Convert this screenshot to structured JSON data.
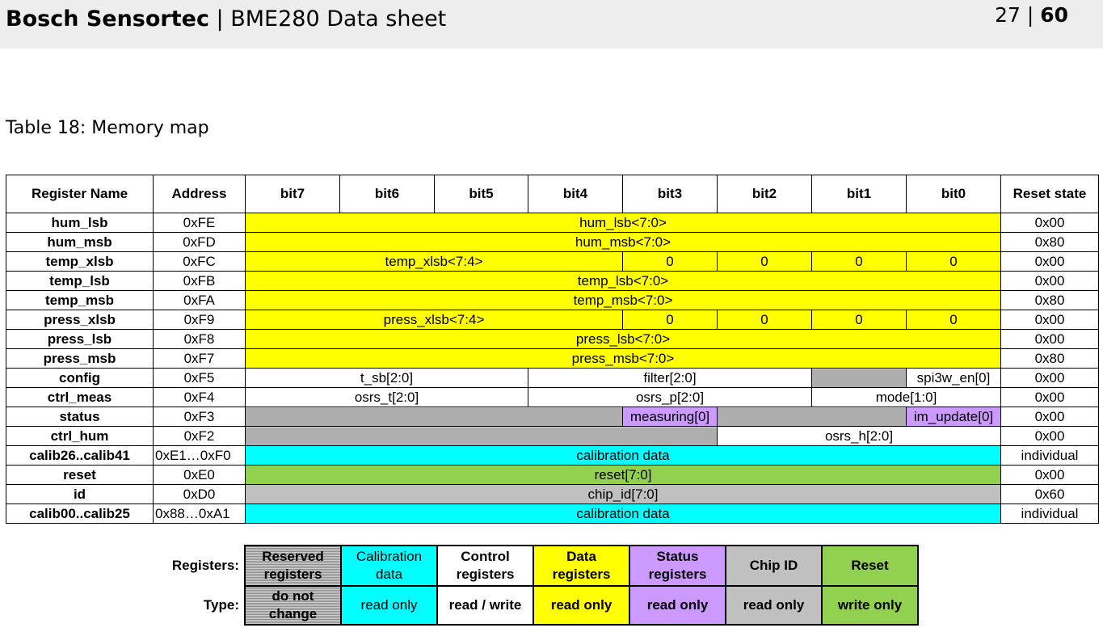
{
  "header": {
    "brand": "Bosch Sensortec",
    "separator": " | ",
    "doc_title": "BME280 Data sheet",
    "page_current": "27",
    "page_sep": " | ",
    "page_total": "60"
  },
  "caption": "Table 18: Memory map",
  "columns": {
    "register_name": "Register Name",
    "address": "Address",
    "bit7": "bit7",
    "bit6": "bit6",
    "bit5": "bit5",
    "bit4": "bit4",
    "bit3": "bit3",
    "bit2": "bit2",
    "bit1": "bit1",
    "bit0": "bit0",
    "reset_state": "Reset state"
  },
  "rows": {
    "hum_lsb": {
      "name": "hum_lsb",
      "address": "0xFE",
      "field": "hum_lsb<7:0>",
      "reset": "0x00"
    },
    "hum_msb": {
      "name": "hum_msb",
      "address": "0xFD",
      "field": "hum_msb<7:0>",
      "reset": "0x80"
    },
    "temp_xlsb": {
      "name": "temp_xlsb",
      "address": "0xFC",
      "field": "temp_xlsb<7:4>",
      "b3": "0",
      "b2": "0",
      "b1": "0",
      "b0": "0",
      "reset": "0x00"
    },
    "temp_lsb": {
      "name": "temp_lsb",
      "address": "0xFB",
      "field": "temp_lsb<7:0>",
      "reset": "0x00"
    },
    "temp_msb": {
      "name": "temp_msb",
      "address": "0xFA",
      "field": "temp_msb<7:0>",
      "reset": "0x80"
    },
    "press_xlsb": {
      "name": "press_xlsb",
      "address": "0xF9",
      "field": "press_xlsb<7:4>",
      "b3": "0",
      "b2": "0",
      "b1": "0",
      "b0": "0",
      "reset": "0x00"
    },
    "press_lsb": {
      "name": "press_lsb",
      "address": "0xF8",
      "field": "press_lsb<7:0>",
      "reset": "0x00"
    },
    "press_msb": {
      "name": "press_msb",
      "address": "0xF7",
      "field": "press_msb<7:0>",
      "reset": "0x80"
    },
    "config": {
      "name": "config",
      "address": "0xF5",
      "t_sb": "t_sb[2:0]",
      "filter": "filter[2:0]",
      "spi3w": "spi3w_en[0]",
      "reset": "0x00"
    },
    "ctrl_meas": {
      "name": "ctrl_meas",
      "address": "0xF4",
      "osrs_t": "osrs_t[2:0]",
      "osrs_p": "osrs_p[2:0]",
      "mode": "mode[1:0]",
      "reset": "0x00"
    },
    "status": {
      "name": "status",
      "address": "0xF3",
      "measuring": "measuring[0]",
      "im_update": "im_update[0]",
      "reset": "0x00"
    },
    "ctrl_hum": {
      "name": "ctrl_hum",
      "address": "0xF2",
      "osrs_h": "osrs_h[2:0]",
      "reset": "0x00"
    },
    "calib26": {
      "name": "calib26..calib41",
      "address": "0xE1…0xF0",
      "field": "calibration data",
      "reset": "individual"
    },
    "reset": {
      "name": "reset",
      "address": "0xE0",
      "field": "reset[7:0]",
      "reset": "0x00"
    },
    "id": {
      "name": "id",
      "address": "0xD0",
      "field": "chip_id[7:0]",
      "reset": "0x60"
    },
    "calib00": {
      "name": "calib00..calib25",
      "address": "0x88…0xA1",
      "field": "calibration data",
      "reset": "individual"
    }
  },
  "legend": {
    "registers_label": "Registers:",
    "type_label": "Type:",
    "items": [
      {
        "register": "Reserved registers",
        "type": "do not change"
      },
      {
        "register": "Calibration data",
        "type": "read only"
      },
      {
        "register": "Control registers",
        "type": "read / write"
      },
      {
        "register": "Data registers",
        "type": "read only"
      },
      {
        "register": "Status registers",
        "type": "read only"
      },
      {
        "register": "Chip ID",
        "type": "read only"
      },
      {
        "register": "Reset",
        "type": "write only"
      }
    ]
  },
  "colors": {
    "data": "#ffff00",
    "calibration": "#00ffff",
    "reset": "#92d050",
    "chip_id": "#c0c0c0",
    "status": "#cc99ff",
    "reserved": "#9a9a9a",
    "control": "#ffffff",
    "header_bg": "#ededed"
  }
}
